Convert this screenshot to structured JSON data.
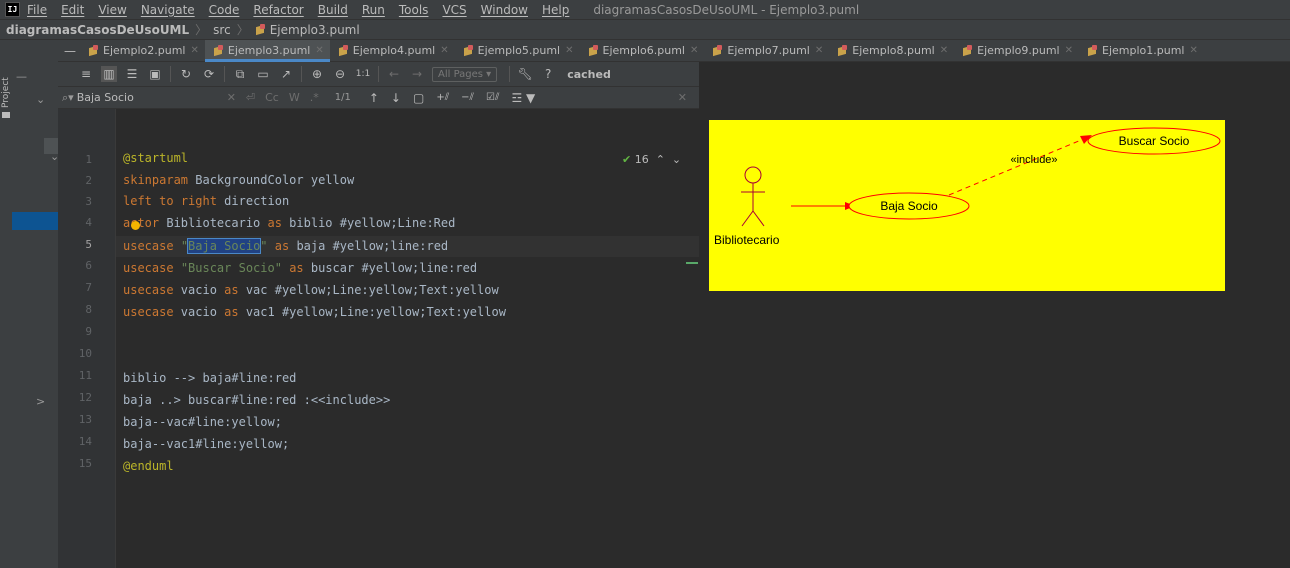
{
  "menubar": {
    "logo": "IJ",
    "items": [
      "File",
      "Edit",
      "View",
      "Navigate",
      "Code",
      "Refactor",
      "Build",
      "Run",
      "Tools",
      "VCS",
      "Window",
      "Help"
    ],
    "window_title": "diagramasCasosDeUsoUML - Ejemplo3.puml"
  },
  "breadcrumb": {
    "project": "diagramasCasosDeUsoUML",
    "folder": "src",
    "file": "Ejemplo3.puml"
  },
  "sidebar": {
    "project_label": "Project"
  },
  "tabs": [
    {
      "label": "Ejemplo2.puml",
      "active": false
    },
    {
      "label": "Ejemplo3.puml",
      "active": true
    },
    {
      "label": "Ejemplo4.puml",
      "active": false
    },
    {
      "label": "Ejemplo5.puml",
      "active": false
    },
    {
      "label": "Ejemplo6.puml",
      "active": false
    },
    {
      "label": "Ejemplo7.puml",
      "active": false
    },
    {
      "label": "Ejemplo8.puml",
      "active": false
    },
    {
      "label": "Ejemplo9.puml",
      "active": false
    },
    {
      "label": "Ejemplo1.puml",
      "active": false
    }
  ],
  "toolbar": {
    "zoom_label": "1:1",
    "pages_select": "All Pages",
    "help_label": "?",
    "cached_label": "cached"
  },
  "search": {
    "value": "Baja Socio",
    "case_label": "Cc",
    "word_label": "W",
    "regex_label": ".*",
    "match_count": "1/1"
  },
  "editor": {
    "line_numbers": [
      "1",
      "2",
      "3",
      "4",
      "5",
      "6",
      "7",
      "8",
      "9",
      "10",
      "11",
      "12",
      "13",
      "14",
      "15"
    ],
    "current_line": "5",
    "inspection_count": "16",
    "lines": [
      "@startuml",
      "skinparam BackgroundColor yellow",
      "left to right direction",
      "actor Bibliotecario as biblio #yellow;Line:Red",
      "usecase \"Baja Socio\" as baja #yellow;line:red",
      "usecase \"Buscar Socio\" as buscar #yellow;line:red",
      "usecase vacio as vac #yellow;Line:yellow;Text:yellow",
      "usecase vacio as vac1 #yellow;Line:yellow;Text:yellow",
      "",
      "",
      "biblio --> baja#line:red",
      "baja ..> buscar#line:red :<<include>>",
      "baja--vac#line:yellow;",
      "baja--vac1#line:yellow;",
      "@enduml"
    ]
  },
  "diagram": {
    "actor_label": "Bibliotecario",
    "usecase1_label": "Baja Socio",
    "usecase2_label": "Buscar Socio",
    "include_label": "«include»",
    "background_color": "#ffff00",
    "line_color": "#ff0000"
  },
  "colors": {
    "accent": "#4a88c7",
    "selection": "#214283",
    "keyword": "#cc7832",
    "string": "#6a8759"
  }
}
